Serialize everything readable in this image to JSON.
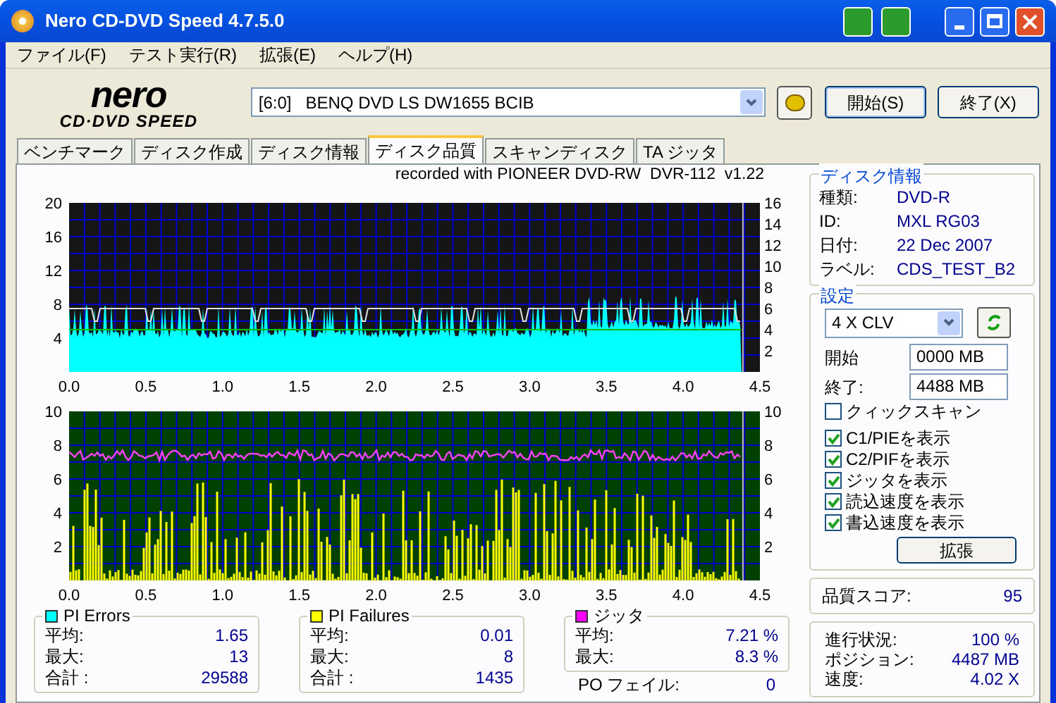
{
  "window": {
    "title": "Nero CD-DVD Speed 4.7.5.0"
  },
  "menu": [
    "ファイル(F)",
    "テスト実行(R)",
    "拡張(E)",
    "ヘルプ(H)"
  ],
  "toolbar": {
    "logo_top": "nero",
    "logo_bottom": "CD·DVD SPEED",
    "drive": "[6:0]   BENQ DVD LS DW1655 BCIB",
    "start_button": "開始(S)",
    "exit_button": "終了(X)"
  },
  "tabs": [
    {
      "label": "ベンチマーク",
      "selected": false
    },
    {
      "label": "ディスク作成",
      "selected": false
    },
    {
      "label": "ディスク情報",
      "selected": false
    },
    {
      "label": "ディスク品質",
      "selected": true
    },
    {
      "label": "スキャンディスク",
      "selected": false
    },
    {
      "label": "TA ジッタ",
      "selected": false
    }
  ],
  "chart_caption": "recorded with PIONEER DVD-RW  DVR-112  v1.22",
  "upper_chart": {
    "left_ticks": [
      "20",
      "16",
      "12",
      "8",
      "4"
    ],
    "right_ticks": [
      "16",
      "14",
      "12",
      "10",
      "8",
      "6",
      "4",
      "2"
    ],
    "x_ticks": [
      "0.0",
      "0.5",
      "1.0",
      "1.5",
      "2.0",
      "2.5",
      "3.0",
      "3.5",
      "4.0",
      "4.5"
    ]
  },
  "lower_chart": {
    "left_ticks": [
      "10",
      "8",
      "6",
      "4",
      "2"
    ],
    "right_ticks": [
      "10",
      "8",
      "6",
      "4",
      "2"
    ],
    "x_ticks": [
      "0.0",
      "0.5",
      "1.0",
      "1.5",
      "2.0",
      "2.5",
      "3.0",
      "3.5",
      "4.0",
      "4.5"
    ]
  },
  "disc_info": {
    "heading": "ディスク情報",
    "rows": [
      {
        "label": "種類:",
        "value": "DVD-R"
      },
      {
        "label": "ID:",
        "value": "MXL RG03"
      },
      {
        "label": "日付:",
        "value": "22 Dec 2007"
      },
      {
        "label": "ラベル:",
        "value": "CDS_TEST_B2"
      }
    ]
  },
  "settings": {
    "heading": "設定",
    "speed": "4 X CLV",
    "start_label": "開始",
    "start_value": "0000 MB",
    "end_label": "終了:",
    "end_value": "4488 MB",
    "checkboxes": [
      {
        "label": "クィックスキャン",
        "checked": false
      },
      {
        "label": "C1/PIEを表示",
        "checked": true
      },
      {
        "label": "C2/PIFを表示",
        "checked": true
      },
      {
        "label": "ジッタを表示",
        "checked": true
      },
      {
        "label": "読込速度を表示",
        "checked": true
      },
      {
        "label": "書込速度を表示",
        "checked": true
      }
    ],
    "extend_button": "拡張"
  },
  "quality": {
    "label": "品質スコア:",
    "value": "95"
  },
  "stats": [
    {
      "title": "PI Errors",
      "color": "#00ffff",
      "rows": [
        {
          "label": "平均:",
          "value": "1.65"
        },
        {
          "label": "最大:",
          "value": "13"
        },
        {
          "label": "合計 :",
          "value": "29588"
        }
      ]
    },
    {
      "title": "PI Failures",
      "color": "#ffff00",
      "rows": [
        {
          "label": "平均:",
          "value": "0.01"
        },
        {
          "label": "最大:",
          "value": "8"
        },
        {
          "label": "合計 :",
          "value": "1435"
        }
      ]
    },
    {
      "title": "ジッタ",
      "color": "#ff00ff",
      "rows": [
        {
          "label": "平均:",
          "value": "7.21 %"
        },
        {
          "label": "最大:",
          "value": "8.3 %"
        }
      ]
    }
  ],
  "po_fail": {
    "label": "PO フェイル:",
    "value": "0"
  },
  "progress": [
    {
      "label": "進行状況:",
      "value": "100 %"
    },
    {
      "label": "ポジション:",
      "value": "4487 MB"
    },
    {
      "label": "速度:",
      "value": "4.02 X"
    }
  ]
}
